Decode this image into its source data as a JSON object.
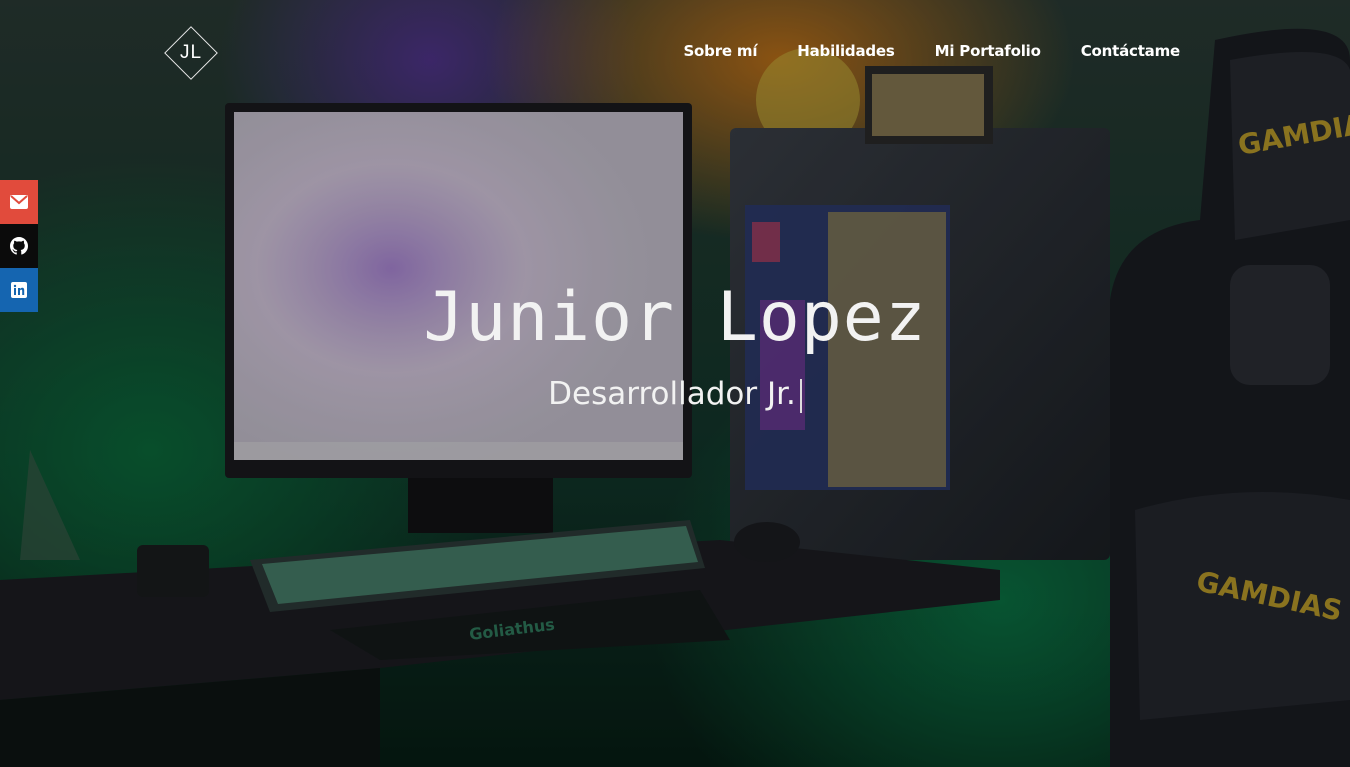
{
  "logo": {
    "text": "JL"
  },
  "nav": {
    "items": [
      {
        "label": "Sobre mí"
      },
      {
        "label": "Habilidades"
      },
      {
        "label": "Mi Portafolio"
      },
      {
        "label": "Contáctame"
      }
    ]
  },
  "social": {
    "items": [
      {
        "icon": "mail-icon",
        "color": "#e14b3c"
      },
      {
        "icon": "github-icon",
        "color": "#0b0b0b"
      },
      {
        "icon": "linkedin-icon",
        "color": "#1565b0"
      }
    ]
  },
  "hero": {
    "name": "Junior Lopez",
    "role": "Desarrollador Jr."
  },
  "scene": {
    "keyboard_brand": "Goliathus",
    "chair_brand": "GAMDIAS"
  }
}
